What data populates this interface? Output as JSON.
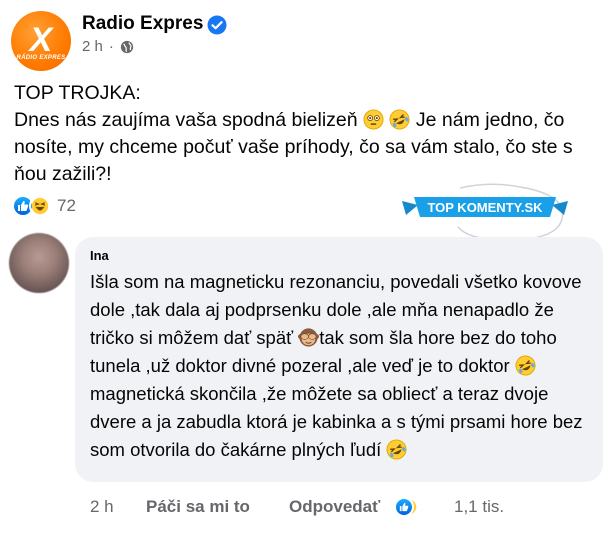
{
  "post": {
    "page_name": "Radio Expres",
    "time": "2 h",
    "avatar_letter": "X",
    "avatar_sub": "RÁDIO EXPRES",
    "text_line1": "TOP TROJKA:",
    "text_seg1": "Dnes nás zaujíma vaša spodná bielizeň ",
    "text_seg2": " Je nám jedno, čo nosíte, my chceme počuť vaše príhody, čo sa vám stalo, čo ste s ňou zažili?!",
    "reaction_count": "72"
  },
  "badge": {
    "text": "TOP KOMENTY.SK"
  },
  "comment": {
    "author": "Ina",
    "seg1": "Išla som na magneticku rezonanciu, povedali všetko kovove dole ,tak dala aj podprsenku dole ,ale mňa nenapadlo že tričko si môžem dať späť ",
    "seg2": "tak som šla hore bez do toho tunela ,už doktor divné pozeral ,ale veď je to doktor ",
    "seg3": " magnetická skončila ,že môžete sa obliecť a teraz dvoje dvere a ja zabudla ktorá je kabinka a s tými prsami hore bez som otvorila do čakárne plných ľudí ",
    "time": "2 h",
    "like_label": "Páči sa mi to",
    "reply_label": "Odpovedať",
    "reaction_count": "1,1 tis."
  },
  "icons": {
    "verified": "verified-badge-icon",
    "globe": "globe-icon",
    "like": "like-reaction-icon",
    "haha": "haha-reaction-icon",
    "monkey": "see-no-evil-monkey-icon",
    "flushed": "flushed-face-icon",
    "rofl": "rolling-on-floor-laughing-icon"
  },
  "colors": {
    "brand_orange": "#ff7a00",
    "facebook_blue": "#1877f2",
    "badge_blue": "#1aa0e8",
    "meta_gray": "#65676b",
    "bubble_bg": "#f0f2f5"
  }
}
